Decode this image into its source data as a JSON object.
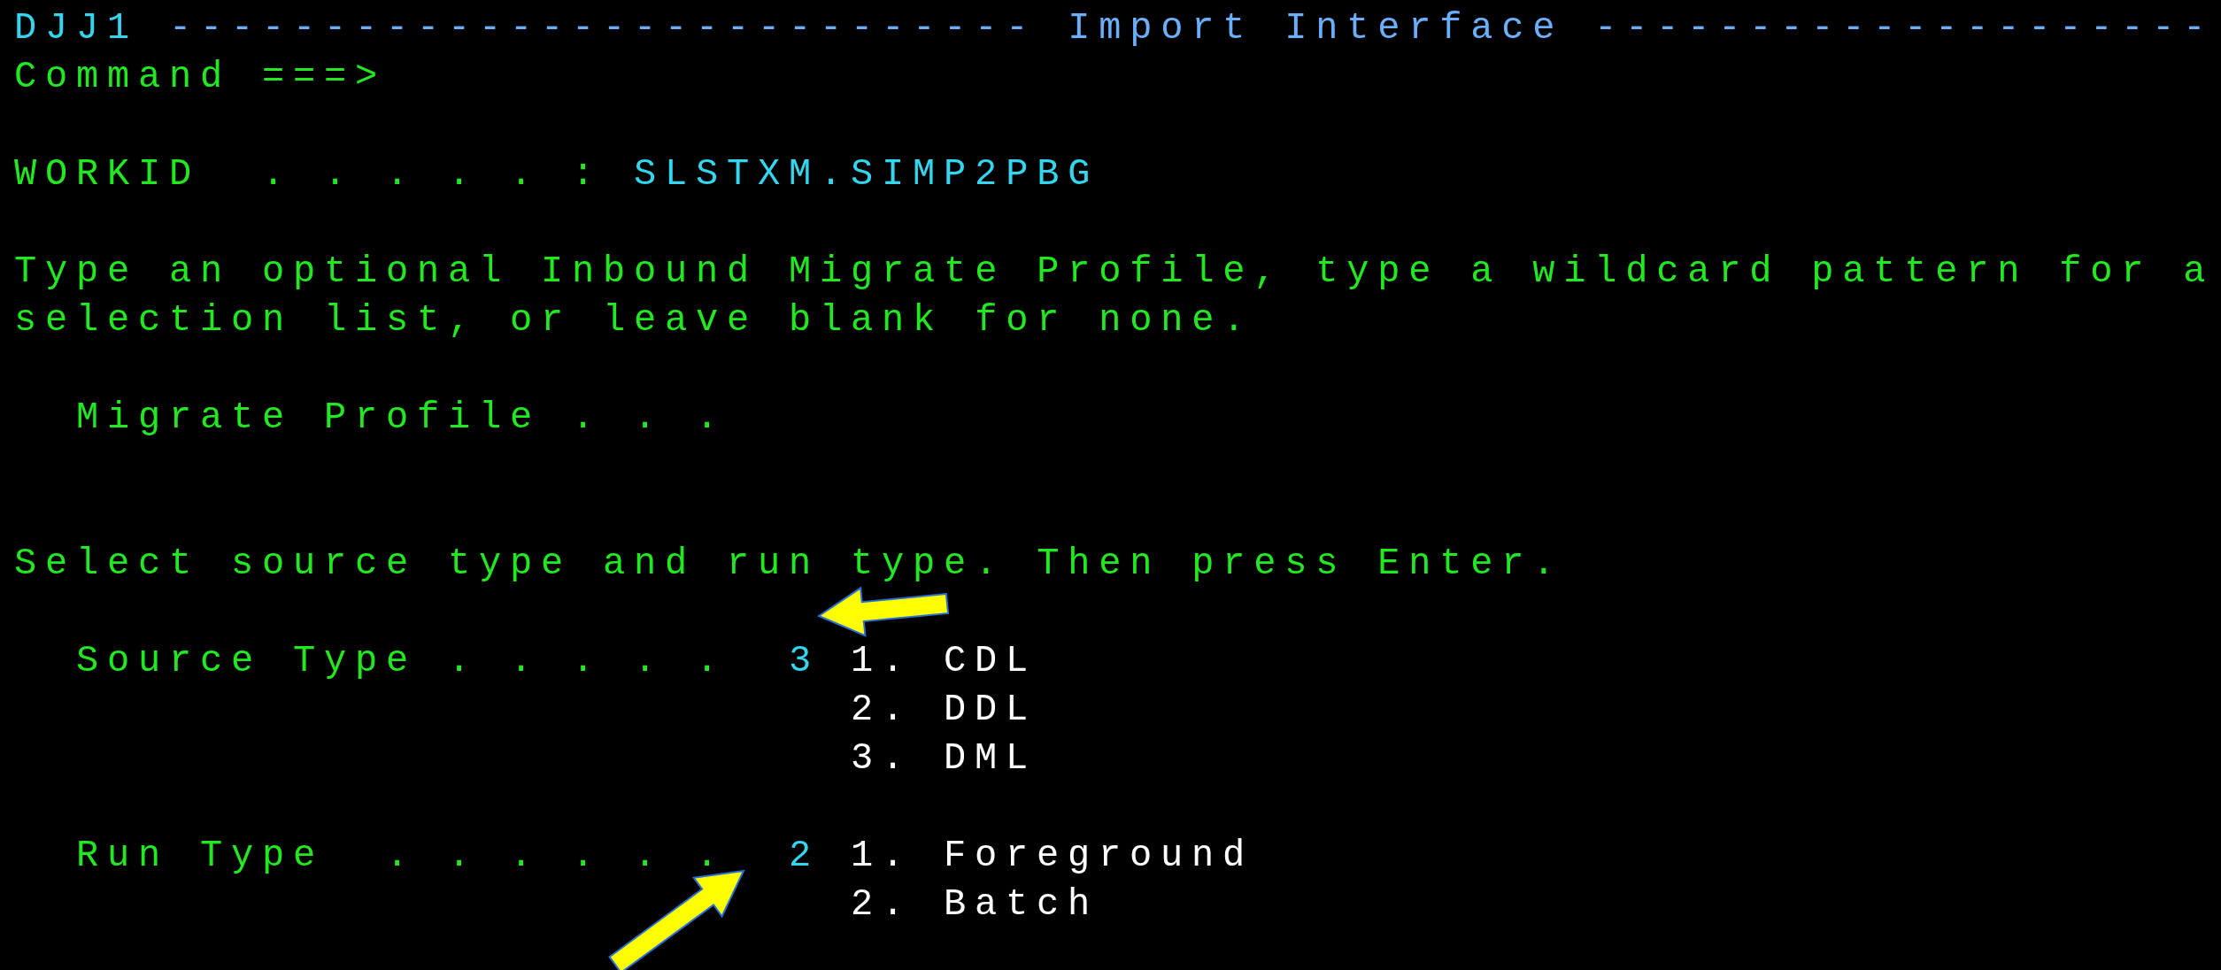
{
  "header": {
    "panel_id": "DJJ1",
    "rule_left": "----------------------------",
    "title": "Import Interface",
    "rule_right": "--------------------"
  },
  "command": {
    "label": "Command ===>"
  },
  "workid": {
    "label": "WORKID  . . . . . :",
    "value": "SLSTXM.SIMP2PBG"
  },
  "instructions": [
    "Type an optional Inbound Migrate Profile, type a wildcard pattern for a",
    "selection list, or leave blank for none."
  ],
  "migrate_profile": {
    "label": "Migrate Profile . . ."
  },
  "prompt": "Select source type and run type. Then press Enter.",
  "fields": [
    {
      "label": "Source Type . . . . .",
      "value": "3",
      "options": [
        "1. CDL",
        "2. DDL",
        "3. DML"
      ]
    },
    {
      "label": "Run Type  . . . . . .",
      "value": "2",
      "options": [
        "1. Foreground",
        "2. Batch"
      ]
    }
  ]
}
